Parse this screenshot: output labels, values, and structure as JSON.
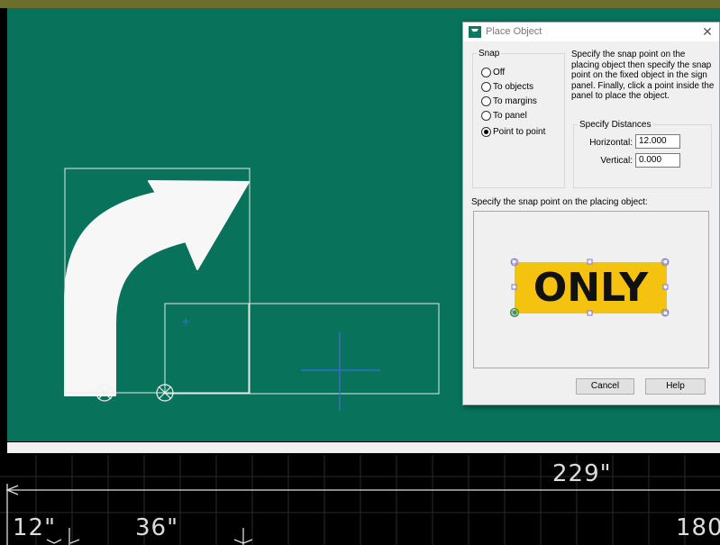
{
  "canvas": {
    "background_color": "#08735a",
    "arrow_color": "#f7f7f7",
    "outline_color": "#e8e8e8",
    "crosshair_color": "#3d6fd6"
  },
  "dimensions": {
    "overall": "229\"",
    "left_offset": "12\"",
    "second_offset": "36\"",
    "right_value": "180"
  },
  "dialog": {
    "title": "Place Object",
    "close_icon": "close-icon",
    "snap_group_label": "Snap",
    "snap_options": [
      {
        "label": "Off",
        "selected": false
      },
      {
        "label": "To objects",
        "selected": false
      },
      {
        "label": "To margins",
        "selected": false
      },
      {
        "label": "To panel",
        "selected": false
      },
      {
        "label": "Point to point",
        "selected": true
      }
    ],
    "instructions": "Specify the snap point on the placing object then specify the snap point on the fixed object in the sign panel. Finally, click a point inside the panel to place the object.",
    "distances_group_label": "Specify Distances",
    "horizontal_label": "Horizontal:",
    "horizontal_value": "12.000",
    "vertical_label": "Vertical:",
    "vertical_value": "0.000",
    "snap_prompt": "Specify the snap point on the placing object:",
    "preview_text": "ONLY",
    "preview_plate_color": "#f5c20f",
    "cancel_label": "Cancel",
    "help_label": "Help"
  }
}
